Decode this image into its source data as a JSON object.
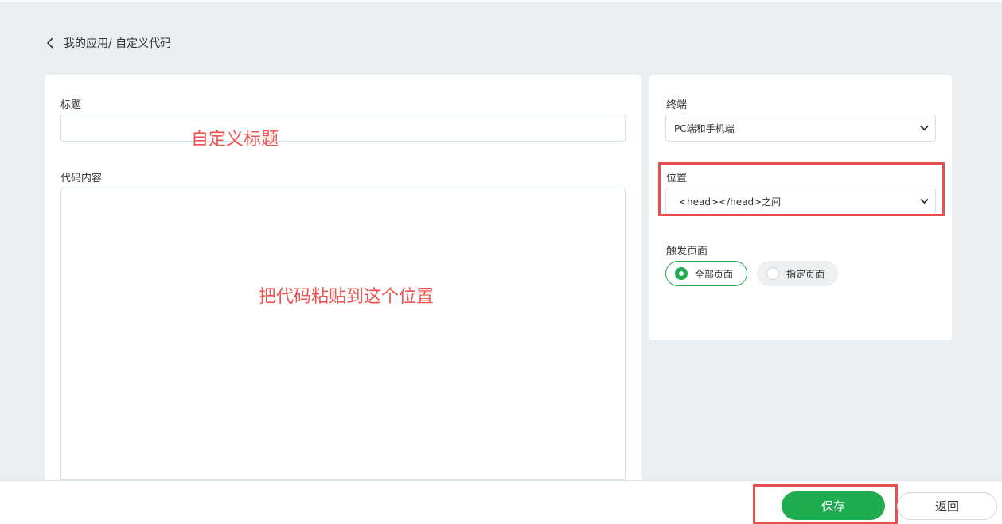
{
  "breadcrumb": {
    "text": "我的应用/ 自定义代码"
  },
  "form": {
    "title_label": "标题",
    "title_value": "",
    "code_label": "代码内容",
    "code_value": ""
  },
  "settings": {
    "terminal_label": "终端",
    "terminal_selected": "PC端和手机端",
    "position_label": "位置",
    "position_selected": "<head></head>之间",
    "trigger_label": "触发页面",
    "trigger_options": [
      {
        "label": "全部页面",
        "selected": true
      },
      {
        "label": "指定页面",
        "selected": false
      }
    ]
  },
  "annotations": {
    "title_hint": "自定义标题",
    "code_hint": "把代码粘贴到这个位置",
    "highlight_color": "#e5504c"
  },
  "footer": {
    "save_label": "保存",
    "back_label": "返回"
  },
  "colors": {
    "accent_green": "#1fab4f",
    "background": "#ebeef1"
  },
  "icons": {
    "back": "chevron-left-icon",
    "dropdown": "chevron-down-icon"
  }
}
